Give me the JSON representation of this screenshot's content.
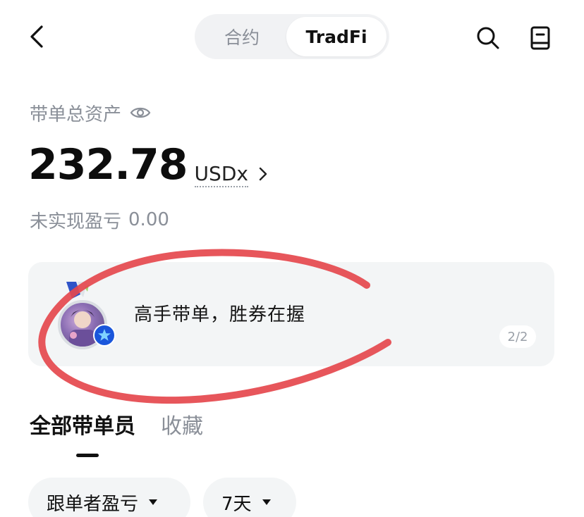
{
  "header": {
    "tabs": [
      {
        "label": "合约",
        "active": false
      },
      {
        "label": "TradFi",
        "active": true
      }
    ],
    "back_icon": "chevron-left-icon",
    "search_icon": "search-icon",
    "guide_icon": "book-icon"
  },
  "assets": {
    "label": "带单总资产",
    "eye_icon": "eye-icon",
    "value": "232.78",
    "unit": "USDx",
    "unrealized_label": "未实现盈亏",
    "unrealized_value": "0.00"
  },
  "banner": {
    "text": "高手带单，胜券在握",
    "pager": "2/2",
    "badge_icon": "star-badge-icon"
  },
  "list_tabs": [
    {
      "label": "全部带单员",
      "active": true
    },
    {
      "label": "收藏",
      "active": false
    }
  ],
  "filters": [
    {
      "label": "跟单者盈亏"
    },
    {
      "label": "7天"
    }
  ],
  "colors": {
    "annotation": "#e5484d",
    "badge": "#1a56db",
    "muted": "#8a8f98"
  }
}
